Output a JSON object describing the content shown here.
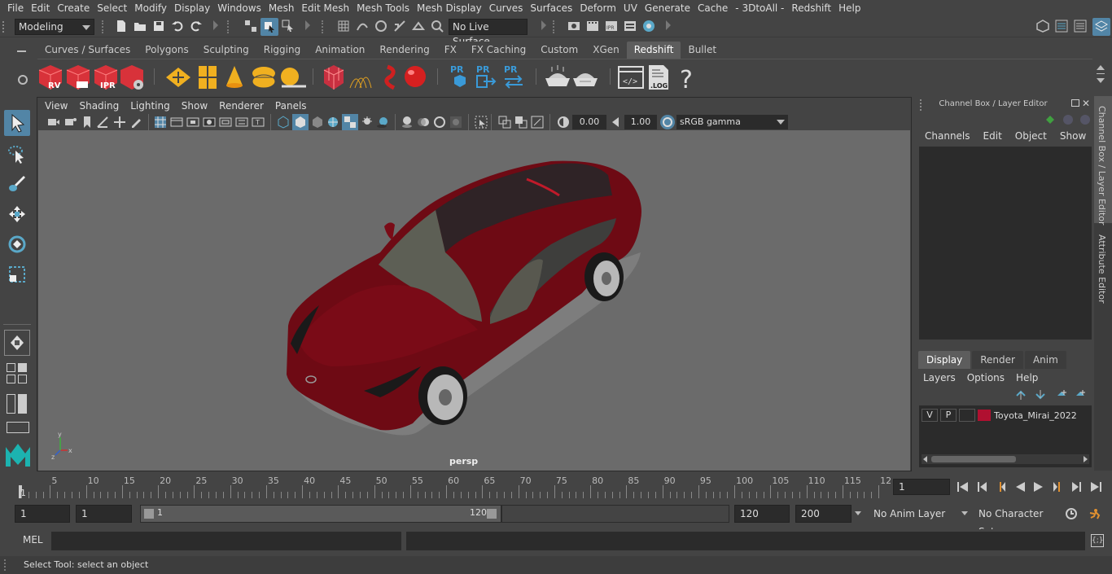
{
  "menubar": {
    "items": [
      "File",
      "Edit",
      "Create",
      "Select",
      "Modify",
      "Display",
      "Windows",
      "Mesh",
      "Edit Mesh",
      "Mesh Tools",
      "Mesh Display",
      "Curves",
      "Surfaces",
      "Deform",
      "UV",
      "Generate",
      "Cache",
      "- 3DtoAll -",
      "Redshift",
      "Help"
    ]
  },
  "statusline": {
    "mode": "Modeling",
    "live_surface": "No Live Surface"
  },
  "shelf": {
    "tabs": [
      "Curves / Surfaces",
      "Polygons",
      "Sculpting",
      "Rigging",
      "Animation",
      "Rendering",
      "FX",
      "FX Caching",
      "Custom",
      "XGen",
      "Redshift",
      "Bullet"
    ],
    "active_tab": "Redshift",
    "icons": {
      "rv": "RV",
      "ipr": "IPR",
      "pr": "PR",
      "log": "LOG",
      "help": "?"
    }
  },
  "viewport": {
    "menus": [
      "View",
      "Shading",
      "Lighting",
      "Show",
      "Renderer",
      "Panels"
    ],
    "exposure": "0.00",
    "gamma": "1.00",
    "colorspace": "sRGB gamma",
    "camera_label": "persp",
    "axis": {
      "x": "x",
      "y": "y",
      "z": "z"
    }
  },
  "channelbox": {
    "title": "Channel Box / Layer Editor",
    "menus": [
      "Channels",
      "Edit",
      "Object",
      "Show"
    ],
    "layer_tabs": [
      "Display",
      "Render",
      "Anim"
    ],
    "active_layer_tab": "Display",
    "layer_menus": [
      "Layers",
      "Options",
      "Help"
    ],
    "layer": {
      "v": "V",
      "p": "P",
      "name": "Toyota_Mirai_2022",
      "color": "#b01030"
    }
  },
  "side_tabs": [
    "Channel Box / Layer Editor",
    "Attribute Editor"
  ],
  "timeslider": {
    "ticks": [
      "5",
      "10",
      "15",
      "20",
      "25",
      "30",
      "35",
      "40",
      "45",
      "50",
      "55",
      "60",
      "65",
      "70",
      "75",
      "80",
      "85",
      "90",
      "95",
      "100",
      "105",
      "110",
      "115",
      "12"
    ],
    "start_marker": "1",
    "current_frame": "1"
  },
  "rangeslider": {
    "start": "1",
    "playback_start": "1",
    "range_start": "1",
    "range_end": "120",
    "playback_end": "120",
    "end": "200",
    "anim_layer": "No Anim Layer",
    "character_set": "No Character Set"
  },
  "cmdline": {
    "language": "MEL"
  },
  "helpline": {
    "text": "Select Tool: select an object"
  },
  "colors": {
    "accent": "#5285a6",
    "car": "#6e0a14",
    "viewport": "#6b6b6b"
  }
}
